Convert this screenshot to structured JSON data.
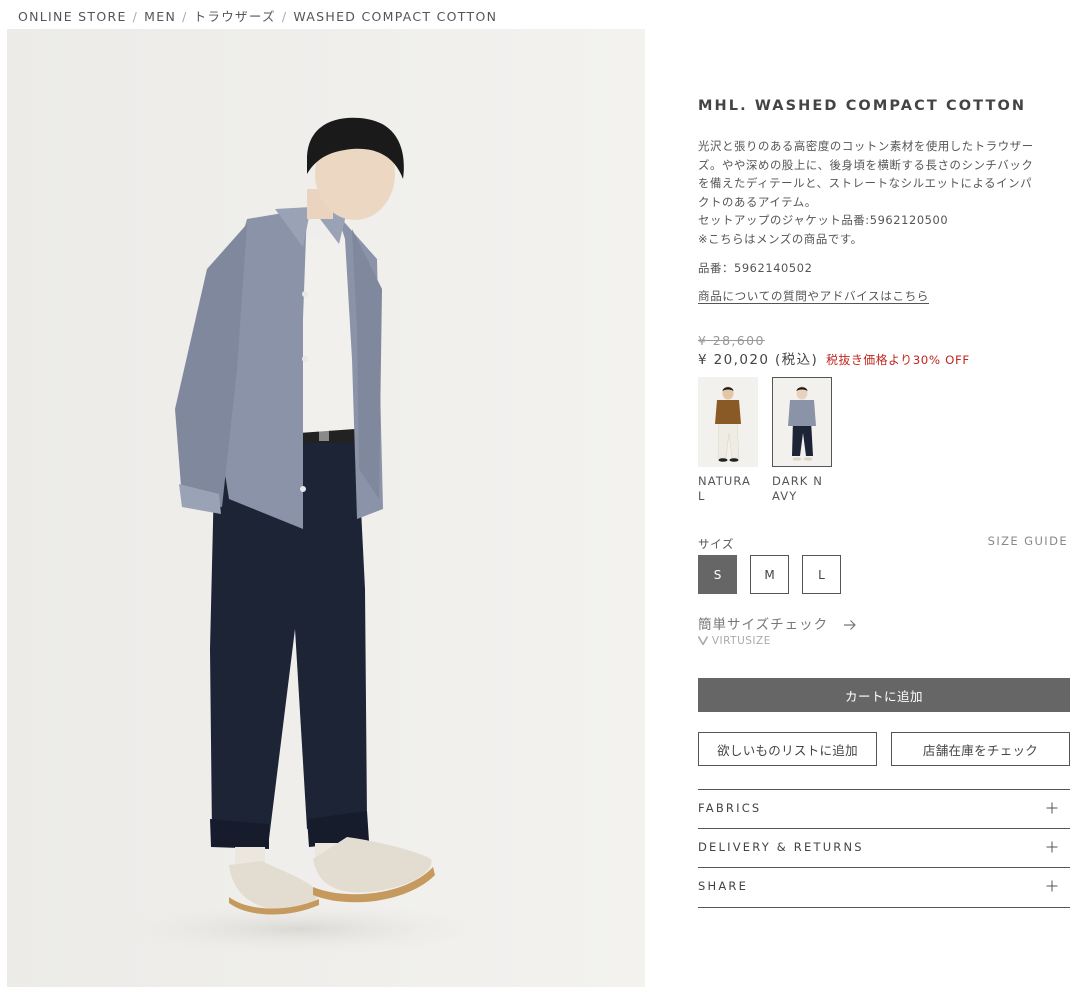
{
  "breadcrumb": {
    "items": [
      "ONLINE STORE",
      "MEN",
      "トラウザーズ",
      "WASHED COMPACT COTTON"
    ],
    "separator": "/"
  },
  "product": {
    "title": "MHL. WASHED COMPACT COTTON",
    "description": [
      "光沢と張りのある高密度のコットン素材を使用したトラウザー",
      "ズ。やや深めの股上に、後身頃を横断する長さのシンチバック",
      "を備えたディテールと、ストレートなシルエットによるインパ",
      "クトのあるアイテム。",
      "セットアップのジャケット品番:5962120500",
      "※こちらはメンズの商品です。"
    ],
    "code": "品番：5962140502",
    "advice_link": "商品についての質問やアドバイスはこちら"
  },
  "price": {
    "original": "¥ 28,600",
    "sale": "¥ 20,020 (税込)",
    "discount": "税抜き価格より30% OFF",
    "discount_color": "#c0261f"
  },
  "colors": [
    {
      "label": "NATURAL",
      "selected": false,
      "shirt": "#8a5a26",
      "pants": "#efece4"
    },
    {
      "label": "DARK NAVY",
      "selected": true,
      "shirt": "#8a93a8",
      "pants": "#1d2436"
    }
  ],
  "size": {
    "label": "サイズ",
    "guide": "SIZE GUIDE",
    "options": [
      "S",
      "M",
      "L"
    ],
    "selected": "S"
  },
  "virtusize": {
    "title": "簡単サイズチェック",
    "brand": "VIRTUSIZE",
    "arrow_icon": "arrow-right-icon"
  },
  "actions": {
    "add_to_cart": "カートに追加",
    "wishlist": "欲しいものリストに追加",
    "store_stock": "店舗在庫をチェック"
  },
  "accordion": [
    {
      "label": "FABRICS",
      "icon": "plus-icon"
    },
    {
      "label": "DELIVERY & RETURNS",
      "icon": "plus-icon"
    },
    {
      "label": "SHARE",
      "icon": "plus-icon"
    }
  ],
  "colors_theme": {
    "cart_button": "#666666",
    "text": "#444444"
  }
}
